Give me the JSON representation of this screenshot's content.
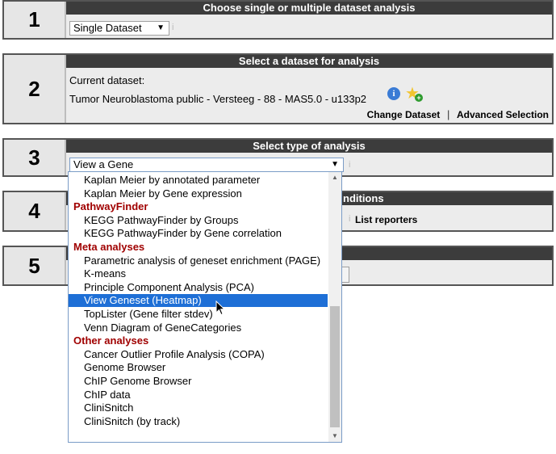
{
  "steps": [
    {
      "number": "1",
      "title": "Choose single or multiple dataset analysis"
    },
    {
      "number": "2",
      "title": "Select a dataset for analysis"
    },
    {
      "number": "3",
      "title": "Select type of analysis"
    },
    {
      "number": "4",
      "title": "nditions"
    },
    {
      "number": "5",
      "title": ""
    }
  ],
  "step1": {
    "selected": "Single Dataset"
  },
  "step2": {
    "current_label": "Current dataset:",
    "dataset_name": "Tumor Neuroblastoma public - Versteeg - 88 - MAS5.0 - u133p2",
    "change_label": "Change Dataset",
    "separator": "|",
    "advanced_label": "Advanced Selection"
  },
  "step3": {
    "selected": "View a Gene"
  },
  "step4": {
    "list_label": "List reporters"
  },
  "dropdown": {
    "items": [
      {
        "type": "opt",
        "label": "Kaplan Meier by annotated parameter"
      },
      {
        "type": "opt",
        "label": "Kaplan Meier by Gene expression"
      },
      {
        "type": "grp",
        "label": "PathwayFinder"
      },
      {
        "type": "opt",
        "label": "KEGG PathwayFinder by Groups"
      },
      {
        "type": "opt",
        "label": "KEGG PathwayFinder by Gene correlation"
      },
      {
        "type": "grp",
        "label": "Meta analyses"
      },
      {
        "type": "opt",
        "label": "Parametric analysis of geneset enrichment (PAGE)"
      },
      {
        "type": "opt",
        "label": "K-means"
      },
      {
        "type": "opt",
        "label": "Principle Component Analysis (PCA)"
      },
      {
        "type": "opt",
        "label": "View Geneset (Heatmap)",
        "highlighted": true
      },
      {
        "type": "opt",
        "label": "TopLister (Gene filter stdev)"
      },
      {
        "type": "opt",
        "label": "Venn Diagram of GeneCategories"
      },
      {
        "type": "grp",
        "label": "Other analyses"
      },
      {
        "type": "opt",
        "label": "Cancer Outlier Profile Analysis (COPA)"
      },
      {
        "type": "opt",
        "label": "Genome Browser"
      },
      {
        "type": "opt",
        "label": "ChIP Genome Browser"
      },
      {
        "type": "opt",
        "label": "ChIP data"
      },
      {
        "type": "opt",
        "label": "CliniSnitch"
      },
      {
        "type": "opt",
        "label": "CliniSnitch (by track)"
      }
    ]
  },
  "colors": {
    "header_bg": "#3c3c3c",
    "group_label": "#a00000",
    "highlight": "#1e6fd6"
  }
}
